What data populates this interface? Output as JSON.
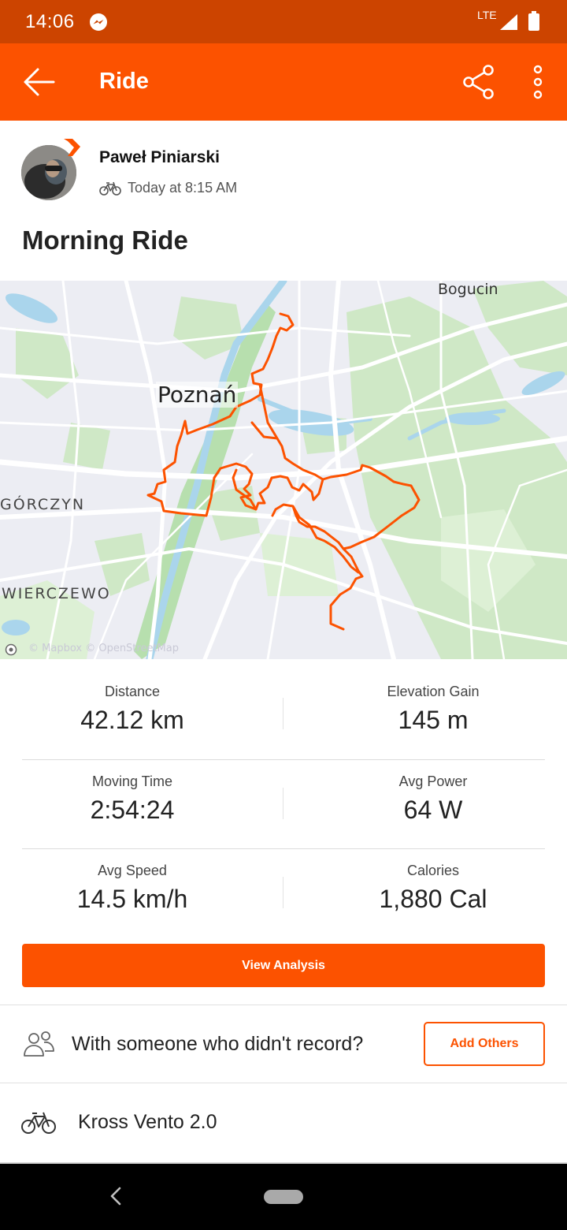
{
  "status_bar": {
    "time": "14:06",
    "network": "LTE",
    "icons": [
      "messenger-icon",
      "signal-icon",
      "battery-icon"
    ]
  },
  "app_bar": {
    "title": "Ride",
    "icons": [
      "back-arrow-icon",
      "share-icon",
      "more-vertical-icon"
    ]
  },
  "activity": {
    "athlete_name": "Paweł Piniarski",
    "date": "Today at 8:15 AM",
    "name": "Morning Ride"
  },
  "map": {
    "labels": {
      "bogucin": "Bogucin",
      "poznan": "Poznań",
      "gorczyn": "GÓRCZYN",
      "wierczewo": "WIERCZEWO"
    },
    "attribution": "© Mapbox © OpenStreetMap",
    "route_color": "#fc5200"
  },
  "stats": [
    {
      "label": "Distance",
      "value": "42.12 km"
    },
    {
      "label": "Elevation Gain",
      "value": "145 m"
    },
    {
      "label": "Moving Time",
      "value": "2:54:24"
    },
    {
      "label": "Avg Power",
      "value": "64 W"
    },
    {
      "label": "Avg Speed",
      "value": "14.5 km/h"
    },
    {
      "label": "Calories",
      "value": "1,880 Cal"
    }
  ],
  "view_analysis_label": "View Analysis",
  "with_others": {
    "text": "With someone who didn't record?",
    "button_label": "Add Others"
  },
  "gear": {
    "name": "Kross Vento 2.0"
  },
  "colors": {
    "brand": "#fc5200",
    "status_bar": "#cc4400"
  }
}
